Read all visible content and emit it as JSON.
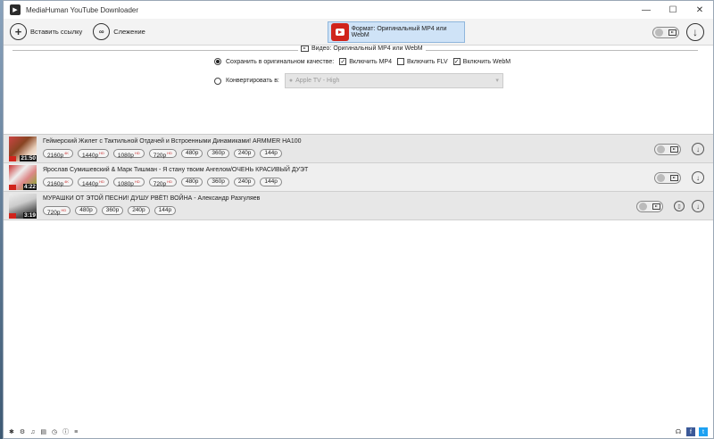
{
  "window": {
    "title": "MediaHuman YouTube Downloader"
  },
  "window_controls": {
    "minimize": "—",
    "maximize": "☐",
    "close": "✕"
  },
  "toolbar": {
    "paste_label": "Вставить ссылку",
    "track_label": "Слежение",
    "format_label": "Формат: Оригинальный MP4 или WebM"
  },
  "settings": {
    "section_title": "Видео: Оригинальный MP4 или WebM",
    "keep_original_label": "Сохранить в оригинальном качестве:",
    "include_mp4": "Включить MP4",
    "include_flv": "Включить FLV",
    "include_webm": "Включить WebM",
    "convert_label": "Конвертировать в:",
    "convert_value": "Apple TV - High"
  },
  "items": [
    {
      "title": "Геймерский Жилет с Тактильной Отдачей и Встроенными Динамиками! ARMMER НА100",
      "duration": "21:50",
      "formats": [
        "2160p",
        "1440p",
        "1080p",
        "720p",
        "480p",
        "360p",
        "240p",
        "144p"
      ],
      "badges": [
        "4K",
        "HD",
        "HD",
        "HD"
      ]
    },
    {
      "title": "Ярослав Сумишевский & Марк Тишман - Я стану твоим Ангелом/ОЧЕНЬ КРАСИВЫЙ ДУЭТ",
      "duration": "4:22",
      "formats": [
        "2160p",
        "1440p",
        "1080p",
        "720p",
        "480p",
        "360p",
        "240p",
        "144p"
      ],
      "badges": [
        "4K",
        "HD",
        "HD",
        "HD"
      ]
    },
    {
      "title": "МУРАШКИ ОТ ЭТОЙ ПЕСНИ! ДУШУ РВЁТ! ВОЙНА - Александр Разгуляев",
      "duration": "3:19",
      "formats": [
        "720p",
        "480p",
        "360p",
        "240p",
        "144p"
      ],
      "badges": [
        "HD"
      ]
    }
  ],
  "icons": {
    "paste": "plus-circle-icon",
    "track": "binoculars-icon",
    "format": "youtube-icon",
    "download": "download-arrow-icon"
  }
}
